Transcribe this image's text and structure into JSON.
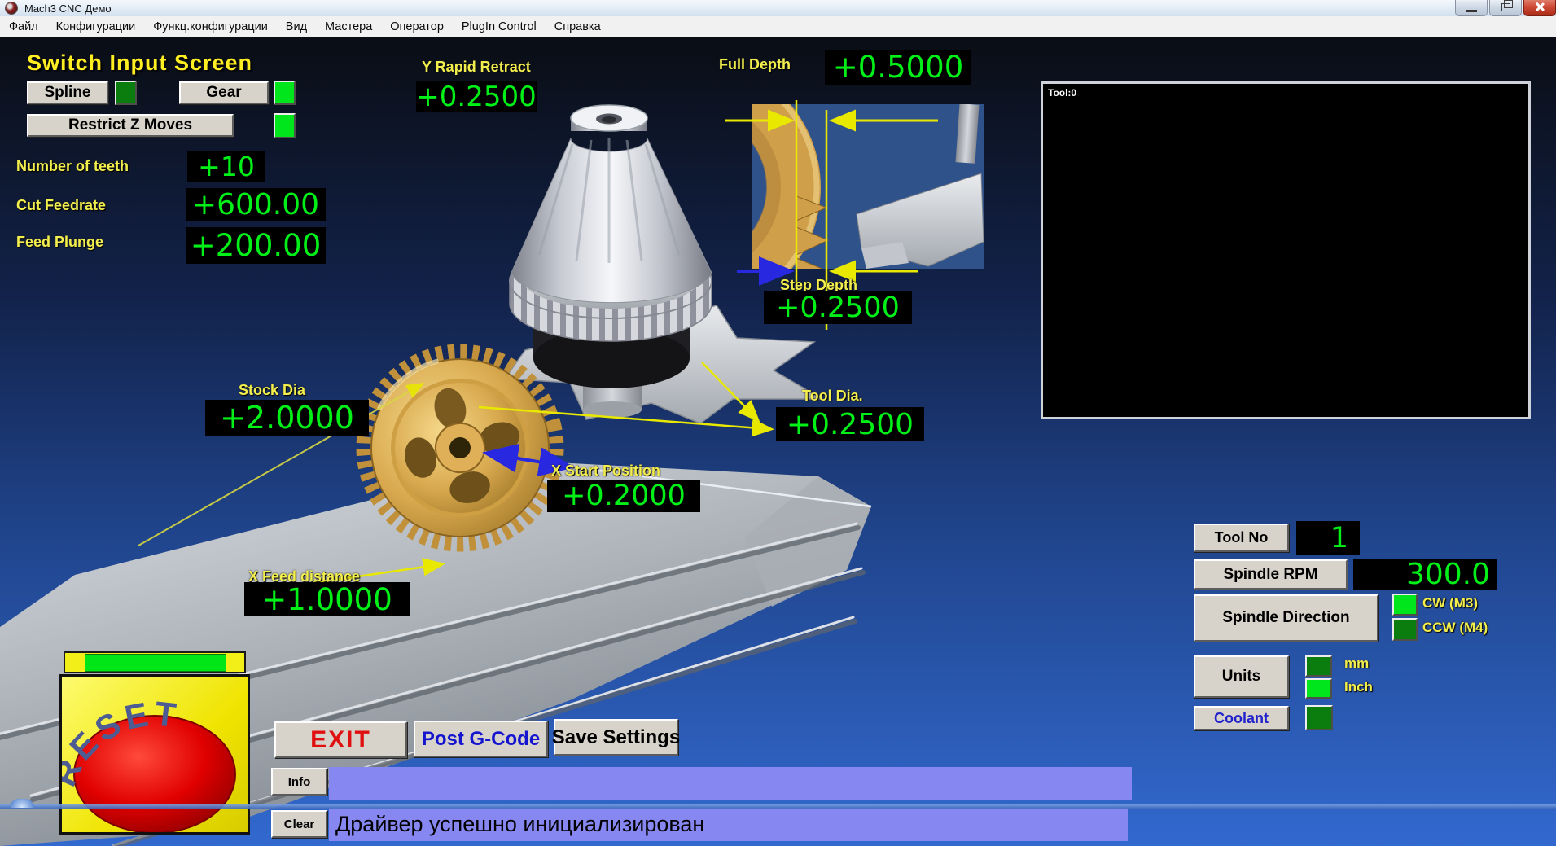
{
  "window": {
    "title": "Mach3 CNC  Демо"
  },
  "menu": {
    "items": [
      "Файл",
      "Конфигурации",
      "Функц.конфигурации",
      "Вид",
      "Мастера",
      "Оператор",
      "PlugIn Control",
      "Справка"
    ]
  },
  "screen": {
    "title": "Switch Input Screen"
  },
  "toggles": {
    "spline": {
      "label": "Spline",
      "led": "dark"
    },
    "gear": {
      "label": "Gear",
      "led": "bright"
    },
    "restrict_z": {
      "label": "Restrict Z Moves",
      "led": "bright"
    }
  },
  "params": [
    {
      "label": "Number of teeth",
      "value": "+10"
    },
    {
      "label": "Cut Feedrate",
      "value": "+600.00"
    },
    {
      "label": "Feed Plunge",
      "value": "+200.00"
    }
  ],
  "dims": {
    "y_rapid_retract": {
      "label": "Y Rapid Retract",
      "value": "+0.2500"
    },
    "full_depth": {
      "label": "Full Depth",
      "value": "+0.5000"
    },
    "step_depth": {
      "label": "Step Depth",
      "value": "+0.2500"
    },
    "stock_dia": {
      "label": "Stock Dia",
      "value": "+2.0000"
    },
    "tool_dia": {
      "label": "Tool Dia.",
      "value": "+0.2500"
    },
    "x_start": {
      "label": "X Start Position",
      "value": "+0.2000"
    },
    "x_feed": {
      "label": "X Feed distance",
      "value": "+1.0000"
    }
  },
  "toolpath": {
    "tool_label": "Tool:0"
  },
  "spindle": {
    "tool_no_label": "Tool No",
    "tool_no_value": "1",
    "rpm_label": "Spindle RPM",
    "rpm_value": "300.0",
    "direction_label": "Spindle Direction",
    "cw_label": "CW (M3)",
    "ccw_label": "CCW (M4)"
  },
  "units": {
    "label": "Units",
    "mm_label": "mm",
    "inch_label": "Inch",
    "coolant_label": "Coolant"
  },
  "reset": {
    "label": "RESET"
  },
  "actions": {
    "exit": "EXIT",
    "post": "Post G-Code",
    "save": "Save Settings",
    "info": "Info",
    "clear": "Clear"
  },
  "status": {
    "message": "Драйвер успешно инициализирован"
  },
  "colors": {
    "dro_green": "#00f018",
    "label_yellow": "#f2ee4e",
    "led_bright": "#00e61c",
    "led_dark": "#0a7d0e",
    "status_bar": "#8787f2",
    "reset_red": "#e00000",
    "reset_yellow": "#f2ef18",
    "exit_red": "#e01010",
    "link_blue": "#1515d0"
  }
}
